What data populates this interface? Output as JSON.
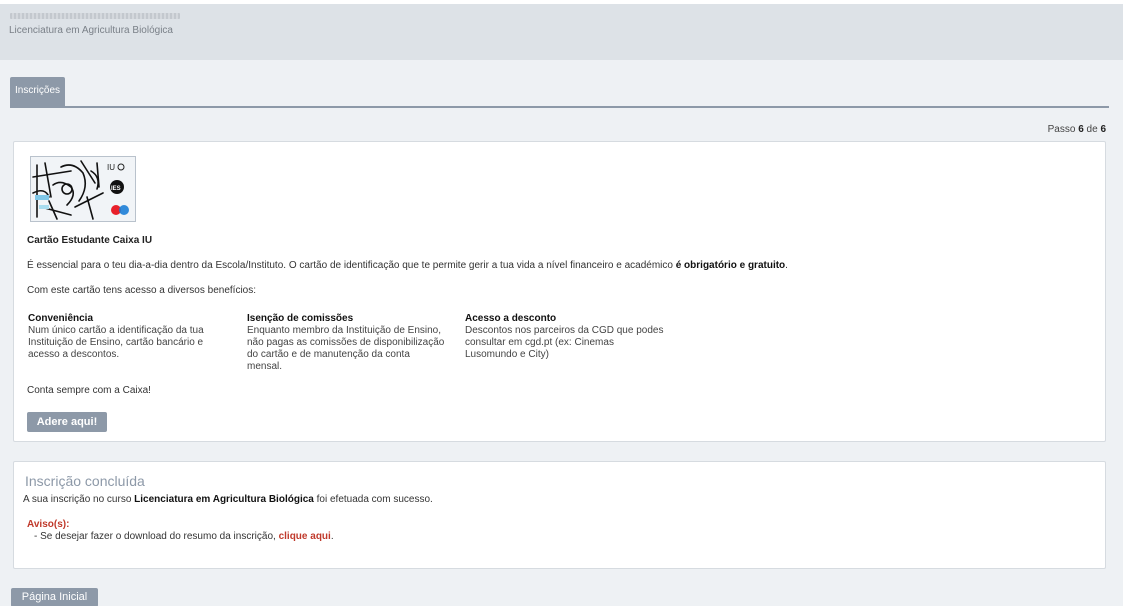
{
  "header": {
    "course": "Licenciatura em Agricultura Biológica"
  },
  "tabs": [
    {
      "label": "Inscrições"
    }
  ],
  "step": {
    "prefix": "Passo",
    "current": "6",
    "sep": "de",
    "total": "6"
  },
  "card": {
    "image_icon": "student-card-image",
    "title": "Cartão Estudante Caixa IU",
    "intro_text": "É essencial para o teu dia-a-dia dentro da Escola/Instituto. O cartão de identificação que te permite gerir a tua vida a nível financeiro e académico ",
    "intro_bold": "é obrigatório e gratuito",
    "intro_end": ".",
    "benefits_intro": "Com este cartão tens acesso a diversos benefícios:",
    "benefits": [
      {
        "title": "Conveniência",
        "lines": [
          "Num único cartão a identificação da tua",
          "Instituição de Ensino, cartão bancário e",
          "acesso a descontos."
        ]
      },
      {
        "title": "Isenção de comissões",
        "lines": [
          "Enquanto membro da Instituição de Ensino,",
          "não pagas as comissões de disponibilização",
          "do cartão e de manutenção da conta",
          "mensal."
        ]
      },
      {
        "title": "Acesso a desconto",
        "lines": [
          "Descontos nos parceiros da CGD que podes",
          "consultar em cgd.pt (ex: Cinemas",
          "Lusomundo e City)"
        ]
      }
    ],
    "closing": "Conta sempre com a Caixa!",
    "button_label": "Adere aqui!"
  },
  "done": {
    "title": "Inscrição concluída",
    "msg_prefix": "A sua inscrição no curso ",
    "msg_course": "Licenciatura em Agricultura Biológica",
    "msg_suffix": " foi efetuada com sucesso.",
    "warn_title": "Aviso(s):",
    "warn_text": "- Se desejar fazer o download do resumo da inscrição, ",
    "warn_link": "clique aqui",
    "warn_end": "."
  },
  "footer": {
    "home_button": "Página Inicial"
  },
  "colors": {
    "accent": "#8d99a8",
    "warning": "#c0392b"
  }
}
